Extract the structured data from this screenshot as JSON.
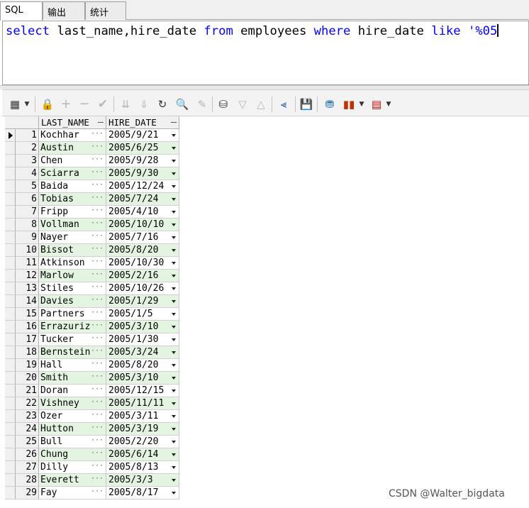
{
  "tabs": [
    {
      "label": "SQL",
      "active": true
    },
    {
      "label": "输出",
      "active": false
    },
    {
      "label": "统计",
      "active": false
    }
  ],
  "editor": {
    "kw_select": "select",
    "cols": " last_name,hire_date ",
    "kw_from": "from",
    "table": " employees ",
    "kw_where": "where",
    "col": " hire_date ",
    "kw_like": "like",
    "literal": " '%05"
  },
  "toolbar_icons": [
    "grid-icon",
    "lock-icon",
    "add-icon",
    "remove-icon",
    "check-icon",
    "down-icon",
    "down-all-icon",
    "refresh-icon",
    "find-icon",
    "clear-icon",
    "query-icon",
    "filter-icon",
    "filter-up-icon",
    "tree-icon",
    "save-icon",
    "export-icon",
    "chart-icon",
    "table-icon"
  ],
  "grid": {
    "columns": [
      "LAST_NAME",
      "HIRE_DATE"
    ],
    "rows": [
      {
        "n": "1",
        "name": "Kochhar",
        "date": "2005/9/21"
      },
      {
        "n": "2",
        "name": "Austin",
        "date": "2005/6/25"
      },
      {
        "n": "3",
        "name": "Chen",
        "date": "2005/9/28"
      },
      {
        "n": "4",
        "name": "Sciarra",
        "date": "2005/9/30"
      },
      {
        "n": "5",
        "name": "Baida",
        "date": "2005/12/24"
      },
      {
        "n": "6",
        "name": "Tobias",
        "date": "2005/7/24"
      },
      {
        "n": "7",
        "name": "Fripp",
        "date": "2005/4/10"
      },
      {
        "n": "8",
        "name": "Vollman",
        "date": "2005/10/10"
      },
      {
        "n": "9",
        "name": "Nayer",
        "date": "2005/7/16"
      },
      {
        "n": "10",
        "name": "Bissot",
        "date": "2005/8/20"
      },
      {
        "n": "11",
        "name": "Atkinson",
        "date": "2005/10/30"
      },
      {
        "n": "12",
        "name": "Marlow",
        "date": "2005/2/16"
      },
      {
        "n": "13",
        "name": "Stiles",
        "date": "2005/10/26"
      },
      {
        "n": "14",
        "name": "Davies",
        "date": "2005/1/29"
      },
      {
        "n": "15",
        "name": "Partners",
        "date": "2005/1/5"
      },
      {
        "n": "16",
        "name": "Errazuriz",
        "date": "2005/3/10"
      },
      {
        "n": "17",
        "name": "Tucker",
        "date": "2005/1/30"
      },
      {
        "n": "18",
        "name": "Bernstein",
        "date": "2005/3/24"
      },
      {
        "n": "19",
        "name": "Hall",
        "date": "2005/8/20"
      },
      {
        "n": "20",
        "name": "Smith",
        "date": "2005/3/10"
      },
      {
        "n": "21",
        "name": "Doran",
        "date": "2005/12/15"
      },
      {
        "n": "22",
        "name": "Vishney",
        "date": "2005/11/11"
      },
      {
        "n": "23",
        "name": "Ozer",
        "date": "2005/3/11"
      },
      {
        "n": "24",
        "name": "Hutton",
        "date": "2005/3/19"
      },
      {
        "n": "25",
        "name": "Bull",
        "date": "2005/2/20"
      },
      {
        "n": "26",
        "name": "Chung",
        "date": "2005/6/14"
      },
      {
        "n": "27",
        "name": "Dilly",
        "date": "2005/8/13"
      },
      {
        "n": "28",
        "name": "Everett",
        "date": "2005/3/3"
      },
      {
        "n": "29",
        "name": "Fay",
        "date": "2005/8/17"
      }
    ]
  },
  "watermark": "CSDN @Walter_bigdata"
}
